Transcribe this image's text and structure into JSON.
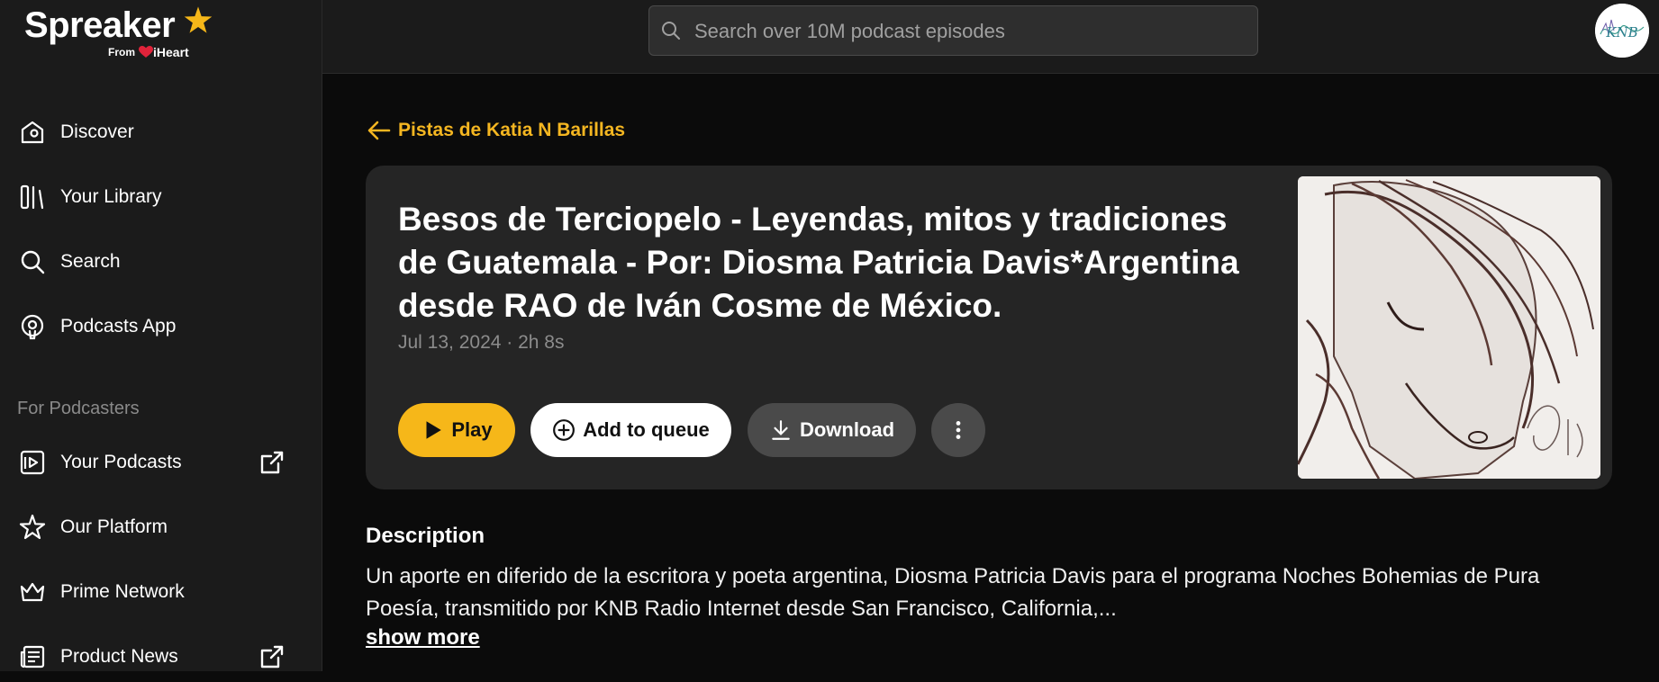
{
  "brand": {
    "name": "Spreaker",
    "from_label": "From",
    "partner": "iHeart",
    "accent_color": "#f6b719"
  },
  "sidebar": {
    "items": [
      {
        "label": "Discover",
        "icon": "home-icon"
      },
      {
        "label": "Your Library",
        "icon": "library-icon"
      },
      {
        "label": "Search",
        "icon": "search-icon"
      },
      {
        "label": "Podcasts App",
        "icon": "podcast-app-icon"
      }
    ],
    "section_label": "For Podcasters",
    "podcaster_items": [
      {
        "label": "Your Podcasts",
        "icon": "your-podcasts-icon",
        "external": true
      },
      {
        "label": "Our Platform",
        "icon": "star-outline-icon",
        "external": false
      },
      {
        "label": "Prime Network",
        "icon": "crown-icon",
        "external": false
      },
      {
        "label": "Product News",
        "icon": "news-icon",
        "external": true
      }
    ]
  },
  "search": {
    "placeholder": "Search over 10M podcast episodes",
    "value": ""
  },
  "avatar": {
    "text": "KNB"
  },
  "back_link": {
    "label": "Pistas de Katia N Barillas"
  },
  "episode": {
    "title": "Besos de Terciopelo - Leyendas, mitos y tradiciones de Guatemala - Por: Diosma Patricia Davis*Argentina desde RAO de Iván Cosme de México.",
    "meta": "Jul 13, 2024 · 2h 8s",
    "actions": {
      "play": "Play",
      "queue": "Add to queue",
      "download": "Download"
    }
  },
  "description": {
    "heading": "Description",
    "body": "Un aporte en diferido de la escritora y poeta argentina, Diosma Patricia Davis para el programa Noches Bohemias de Pura Poesía, transmitido por KNB Radio Internet desde San Francisco, California,...",
    "show_more": "show more"
  }
}
